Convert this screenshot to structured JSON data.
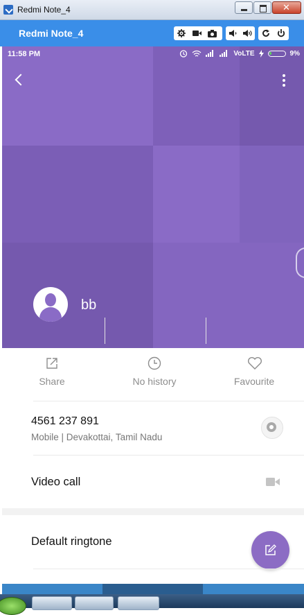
{
  "window": {
    "title": "Redmi Note_4",
    "controls": [
      "minimize",
      "maximize",
      "close"
    ]
  },
  "emulator": {
    "device_name": "Redmi Note_4",
    "tools": [
      "settings-icon",
      "video-record-icon",
      "camera-icon",
      "volume-down-icon",
      "volume-up-icon",
      "rotate-icon",
      "power-icon"
    ]
  },
  "status_bar": {
    "time": "11:58 PM",
    "network": "VoLTE",
    "battery": "9%"
  },
  "contact": {
    "name": "bb",
    "accent_color": "#8a6bc6"
  },
  "actions": {
    "share": "Share",
    "history": "No history",
    "favourite": "Favourite"
  },
  "phone_entry": {
    "number": "4561 237 891",
    "details": "Mobile  |  Devakottai, Tamil Nadu"
  },
  "video_call": {
    "label": "Video call"
  },
  "ringtone": {
    "label": "Default ringtone"
  }
}
